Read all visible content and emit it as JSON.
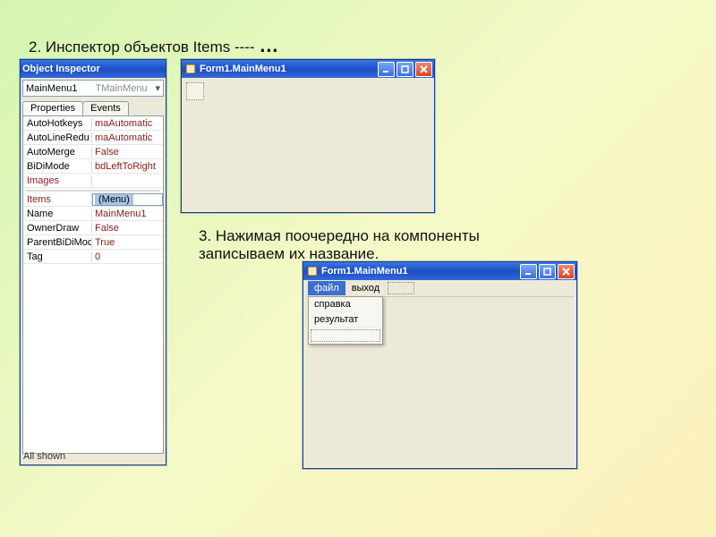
{
  "captions": {
    "c1_a": "2. Инспектор объектов Items ---- ",
    "c1_b": "…",
    "c2_a": "3. Нажимая поочередно на компоненты",
    "c2_b": "записываем  их название."
  },
  "inspector": {
    "title": "Object Inspector",
    "combo": {
      "name": "MainMenu1",
      "type": "TMainMenu",
      "arrow": "▾"
    },
    "tabs": {
      "properties": "Properties",
      "events": "Events"
    },
    "rows": [
      {
        "name": "AutoHotkeys",
        "value": "maAutomatic"
      },
      {
        "name": "AutoLineRedu",
        "value": "maAutomatic"
      },
      {
        "name": "AutoMerge",
        "value": "False"
      },
      {
        "name": "BiDiMode",
        "value": "bdLeftToRight"
      },
      {
        "name": "Images",
        "value": "",
        "link": true
      },
      {
        "name": "Items",
        "value": "(Menu)",
        "selected": true
      },
      {
        "name": "Name",
        "value": "MainMenu1"
      },
      {
        "name": "OwnerDraw",
        "value": "False"
      },
      {
        "name": "ParentBiDiMod",
        "value": "True"
      },
      {
        "name": "Tag",
        "value": "0"
      }
    ],
    "status": "All shown"
  },
  "form_small": {
    "title": "Form1.MainMenu1"
  },
  "form_big": {
    "title": "Form1.MainMenu1",
    "menu": {
      "file": "файл",
      "exit": "выход"
    },
    "dropdown": {
      "help": "справка",
      "result": "результат"
    }
  },
  "winbtn": {
    "min": "_",
    "max": "□",
    "close": "×"
  }
}
